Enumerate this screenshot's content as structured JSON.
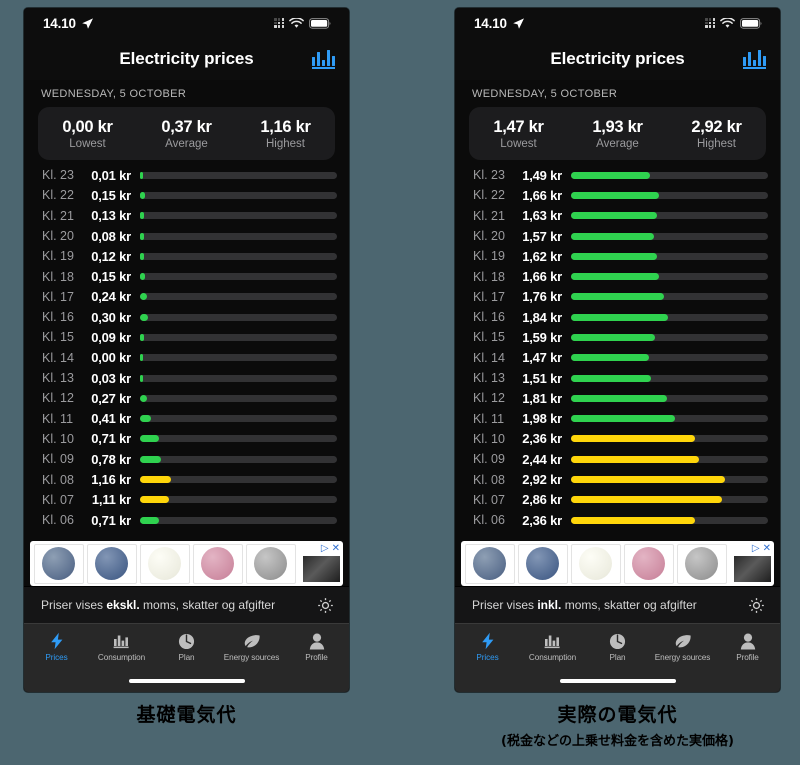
{
  "background_color": "#4c6670",
  "accent_color": "#2f9bf5",
  "bar_colors": {
    "green": "#2fd24f",
    "yellow": "#ffd60a",
    "track": "#323234"
  },
  "phones": [
    {
      "id": "basic-price-phone",
      "statusbar": {
        "time": "14.10",
        "location_icon": "location-arrow-icon",
        "cellular_icon": "cellular-signal-icon",
        "wifi_icon": "wifi-icon",
        "battery_icon": "battery-icon"
      },
      "navbar": {
        "title": "Electricity prices",
        "action_icon": "bar-chart-icon"
      },
      "date_header": "WEDNESDAY, 5 OCTOBER",
      "summary": [
        {
          "value": "0,00 kr",
          "label": "Lowest"
        },
        {
          "value": "0,37 kr",
          "label": "Average"
        },
        {
          "value": "1,16 kr",
          "label": "Highest"
        }
      ],
      "rows": [
        {
          "hour": "Kl. 23",
          "price": "0,01 kr",
          "pct": 0.9,
          "color": "green"
        },
        {
          "hour": "Kl. 22",
          "price": "0,15 kr",
          "pct": 2.4,
          "color": "green"
        },
        {
          "hour": "Kl. 21",
          "price": "0,13 kr",
          "pct": 2.2,
          "color": "green"
        },
        {
          "hour": "Kl. 20",
          "price": "0,08 kr",
          "pct": 1.8,
          "color": "green"
        },
        {
          "hour": "Kl. 19",
          "price": "0,12 kr",
          "pct": 2.1,
          "color": "green"
        },
        {
          "hour": "Kl. 18",
          "price": "0,15 kr",
          "pct": 2.4,
          "color": "green"
        },
        {
          "hour": "Kl. 17",
          "price": "0,24 kr",
          "pct": 3.3,
          "color": "green"
        },
        {
          "hour": "Kl. 16",
          "price": "0,30 kr",
          "pct": 4.2,
          "color": "green"
        },
        {
          "hour": "Kl. 15",
          "price": "0,09 kr",
          "pct": 1.9,
          "color": "green"
        },
        {
          "hour": "Kl. 14",
          "price": "0,00 kr",
          "pct": 0.0,
          "color": "green"
        },
        {
          "hour": "Kl. 13",
          "price": "0,03 kr",
          "pct": 1.0,
          "color": "green"
        },
        {
          "hour": "Kl. 12",
          "price": "0,27 kr",
          "pct": 3.6,
          "color": "green"
        },
        {
          "hour": "Kl. 11",
          "price": "0,41 kr",
          "pct": 5.4,
          "color": "green"
        },
        {
          "hour": "Kl. 10",
          "price": "0,71 kr",
          "pct": 9.6,
          "color": "green"
        },
        {
          "hour": "Kl. 09",
          "price": "0,78 kr",
          "pct": 10.5,
          "color": "green"
        },
        {
          "hour": "Kl. 08",
          "price": "1,16 kr",
          "pct": 15.6,
          "color": "yellow"
        },
        {
          "hour": "Kl. 07",
          "price": "1,11 kr",
          "pct": 14.9,
          "color": "yellow"
        },
        {
          "hour": "Kl. 06",
          "price": "0,71 kr",
          "pct": 9.6,
          "color": "green"
        }
      ],
      "ad": {
        "close_icon": "close-icon",
        "info_icon": "ad-choices-icon"
      },
      "footnote": {
        "prefix": "Priser vises ",
        "emphasis": "ekskl.",
        "suffix": " moms, skatter og afgifter",
        "settings_icon": "gear-icon"
      },
      "caption": {
        "main": "基礎電気代",
        "sub": ""
      }
    },
    {
      "id": "actual-price-phone",
      "statusbar": {
        "time": "14.10",
        "location_icon": "location-arrow-icon",
        "cellular_icon": "cellular-signal-icon",
        "wifi_icon": "wifi-icon",
        "battery_icon": "battery-icon"
      },
      "navbar": {
        "title": "Electricity prices",
        "action_icon": "bar-chart-icon"
      },
      "date_header": "WEDNESDAY, 5 OCTOBER",
      "summary": [
        {
          "value": "1,47 kr",
          "label": "Lowest"
        },
        {
          "value": "1,93 kr",
          "label": "Average"
        },
        {
          "value": "2,92 kr",
          "label": "Highest"
        }
      ],
      "rows": [
        {
          "hour": "Kl. 23",
          "price": "1,49 kr",
          "pct": 40.0,
          "color": "green"
        },
        {
          "hour": "Kl. 22",
          "price": "1,66 kr",
          "pct": 44.5,
          "color": "green"
        },
        {
          "hour": "Kl. 21",
          "price": "1,63 kr",
          "pct": 43.7,
          "color": "green"
        },
        {
          "hour": "Kl. 20",
          "price": "1,57 kr",
          "pct": 42.2,
          "color": "green"
        },
        {
          "hour": "Kl. 19",
          "price": "1,62 kr",
          "pct": 43.5,
          "color": "green"
        },
        {
          "hour": "Kl. 18",
          "price": "1,66 kr",
          "pct": 44.5,
          "color": "green"
        },
        {
          "hour": "Kl. 17",
          "price": "1,76 kr",
          "pct": 47.2,
          "color": "green"
        },
        {
          "hour": "Kl. 16",
          "price": "1,84 kr",
          "pct": 49.4,
          "color": "green"
        },
        {
          "hour": "Kl. 15",
          "price": "1,59 kr",
          "pct": 42.7,
          "color": "green"
        },
        {
          "hour": "Kl. 14",
          "price": "1,47 kr",
          "pct": 39.5,
          "color": "green"
        },
        {
          "hour": "Kl. 13",
          "price": "1,51 kr",
          "pct": 40.5,
          "color": "green"
        },
        {
          "hour": "Kl. 12",
          "price": "1,81 kr",
          "pct": 48.6,
          "color": "green"
        },
        {
          "hour": "Kl. 11",
          "price": "1,98 kr",
          "pct": 53.0,
          "color": "green"
        },
        {
          "hour": "Kl. 10",
          "price": "2,36 kr",
          "pct": 63.0,
          "color": "yellow"
        },
        {
          "hour": "Kl. 09",
          "price": "2,44 kr",
          "pct": 65.2,
          "color": "yellow"
        },
        {
          "hour": "Kl. 08",
          "price": "2,92 kr",
          "pct": 78.0,
          "color": "yellow"
        },
        {
          "hour": "Kl. 07",
          "price": "2,86 kr",
          "pct": 76.5,
          "color": "yellow"
        },
        {
          "hour": "Kl. 06",
          "price": "2,36 kr",
          "pct": 63.0,
          "color": "yellow"
        }
      ],
      "ad": {
        "close_icon": "close-icon",
        "info_icon": "ad-choices-icon"
      },
      "footnote": {
        "prefix": "Priser vises ",
        "emphasis": "inkl.",
        "suffix": " moms, skatter og afgifter",
        "settings_icon": "gear-icon"
      },
      "caption": {
        "main": "実際の電気代",
        "sub": "(税金などの上乗せ料金を含めた実価格)"
      }
    }
  ],
  "tabs": [
    {
      "label": "Prices",
      "icon": "bolt-icon",
      "active": true
    },
    {
      "label": "Consumption",
      "icon": "bar-chart-icon",
      "active": false
    },
    {
      "label": "Plan",
      "icon": "clock-pie-icon",
      "active": false
    },
    {
      "label": "Energy sources",
      "icon": "leaf-icon",
      "active": false
    },
    {
      "label": "Profile",
      "icon": "person-icon",
      "active": false
    }
  ]
}
